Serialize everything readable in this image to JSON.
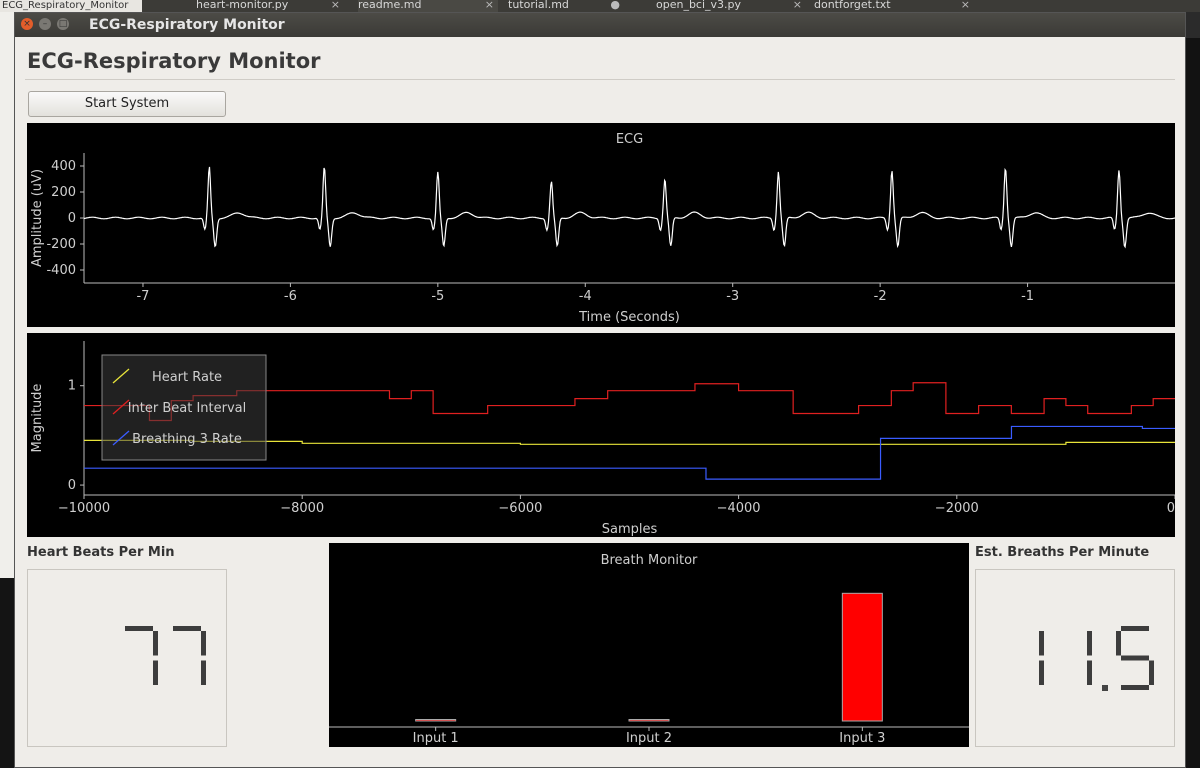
{
  "desktop": {
    "tabs": [
      "ECG_Respiratory_Monitor",
      "heart-monitor.py",
      "readme.md",
      "tutorial.md",
      "open_bci_v3.py",
      "dontforget.txt"
    ]
  },
  "window": {
    "title": "ECG-Respiratory Monitor",
    "buttons": [
      "close",
      "minimize",
      "maximize"
    ]
  },
  "app": {
    "title": "ECG-Respiratory Monitor",
    "start_button": "Start System"
  },
  "heart_panel": {
    "label": "Heart Beats Per Min",
    "value": "77"
  },
  "breath_panel": {
    "label": "Est. Breaths Per Minute",
    "value": "11.5"
  },
  "colors": {
    "heart_rate": "#e8e43a",
    "inter_beat_interval": "#e02020",
    "breathing_rate": "#3a5cff",
    "breath_bar": "#ff0000",
    "ecg_trace": "#ffffff"
  },
  "chart_data": [
    {
      "type": "line",
      "title": "ECG",
      "xlabel": "Time (Seconds)",
      "ylabel": "Amplitude (uV)",
      "xlim": [
        -7.4,
        0
      ],
      "ylim": [
        -500,
        500
      ],
      "xticks": [
        -7,
        -6,
        -5,
        -4,
        -3,
        -2,
        -1
      ],
      "yticks": [
        400,
        200,
        0,
        -200,
        -400
      ],
      "beat_times": [
        -6.55,
        -5.77,
        -5.0,
        -4.23,
        -3.46,
        -2.69,
        -1.92,
        -1.15,
        -0.38
      ],
      "peak_amplitudes": [
        390,
        390,
        350,
        280,
        300,
        360,
        370,
        390,
        370
      ],
      "grid": false
    },
    {
      "type": "line",
      "title": "",
      "xlabel": "Samples",
      "ylabel": "Magnitude",
      "xlim": [
        -10000,
        0
      ],
      "ylim": [
        -0.1,
        1.45
      ],
      "xticks": [
        -10000,
        -8000,
        -6000,
        -4000,
        -2000,
        0
      ],
      "yticks": [
        1,
        0
      ],
      "legend": "top-left",
      "series": [
        {
          "name": "Heart Rate",
          "color": "#e8e43a",
          "x": [
            -10000,
            -9500,
            -9000,
            -8000,
            -7000,
            -6000,
            -5000,
            -4000,
            -3000,
            -2000,
            -1000,
            0
          ],
          "values": [
            0.45,
            0.45,
            0.44,
            0.42,
            0.42,
            0.41,
            0.41,
            0.41,
            0.41,
            0.41,
            0.43,
            0.43
          ]
        },
        {
          "name": "Inter Beat Interval",
          "color": "#e02020",
          "x": [
            -10000,
            -9700,
            -9400,
            -9200,
            -9000,
            -8600,
            -8200,
            -7500,
            -7200,
            -7000,
            -6800,
            -6500,
            -6300,
            -5800,
            -5500,
            -5300,
            -5200,
            -4800,
            -4400,
            -4000,
            -3800,
            -3500,
            -3200,
            -2900,
            -2600,
            -2400,
            -2100,
            -1800,
            -1500,
            -1200,
            -1000,
            -800,
            -600,
            -400,
            -300,
            -200,
            0
          ],
          "values": [
            0.8,
            0.8,
            0.65,
            0.85,
            0.9,
            0.95,
            0.95,
            0.95,
            0.87,
            0.95,
            0.72,
            0.72,
            0.8,
            0.8,
            0.87,
            0.87,
            0.95,
            0.95,
            1.02,
            0.95,
            0.95,
            0.72,
            0.72,
            0.8,
            0.95,
            1.03,
            0.72,
            0.8,
            0.72,
            0.87,
            0.8,
            0.72,
            0.72,
            0.8,
            0.8,
            0.87,
            0.87
          ]
        },
        {
          "name": "Breathing 3 Rate",
          "color": "#3a5cff",
          "x": [
            -10000,
            -4300,
            -4299,
            -2700,
            -2699,
            -1500,
            -1499,
            -300,
            -299,
            0
          ],
          "values": [
            0.17,
            0.17,
            0.06,
            0.06,
            0.47,
            0.47,
            0.59,
            0.59,
            0.57,
            0.57
          ]
        }
      ],
      "grid": false
    },
    {
      "type": "bar",
      "title": "Breath Monitor",
      "categories": [
        "Input 1",
        "Input 2",
        "Input 3"
      ],
      "values": [
        0.01,
        0.01,
        1.0
      ],
      "ylim": [
        0,
        1.3
      ],
      "grid": false
    }
  ]
}
